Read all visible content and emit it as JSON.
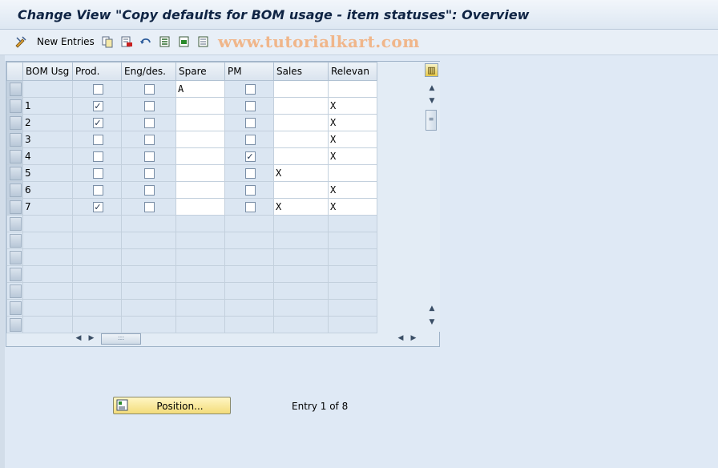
{
  "window": {
    "title": "Change View \"Copy defaults for BOM usage - item statuses\": Overview"
  },
  "toolbar": {
    "new_entries_label": "New Entries",
    "watermark": "www.tutorialkart.com"
  },
  "table": {
    "columns": [
      "BOM Usg",
      "Prod.",
      "Eng/des.",
      "Spare",
      "PM",
      "Sales",
      "Relevan"
    ],
    "rows": [
      {
        "bom": "",
        "prod": false,
        "eng": false,
        "spare": "A",
        "pm": false,
        "sales": "",
        "rel": ""
      },
      {
        "bom": "1",
        "prod": true,
        "eng": false,
        "spare": "",
        "pm": false,
        "sales": "",
        "rel": "X"
      },
      {
        "bom": "2",
        "prod": true,
        "eng": false,
        "spare": "",
        "pm": false,
        "sales": "",
        "rel": "X"
      },
      {
        "bom": "3",
        "prod": false,
        "eng": false,
        "spare": "",
        "pm": false,
        "sales": "",
        "rel": "X"
      },
      {
        "bom": "4",
        "prod": false,
        "eng": false,
        "spare": "",
        "pm": true,
        "sales": "",
        "rel": "X"
      },
      {
        "bom": "5",
        "prod": false,
        "eng": false,
        "spare": "",
        "pm": false,
        "sales": "X",
        "rel": ""
      },
      {
        "bom": "6",
        "prod": false,
        "eng": false,
        "spare": "",
        "pm": false,
        "sales": "",
        "rel": "X"
      },
      {
        "bom": "7",
        "prod": true,
        "eng": false,
        "spare": "",
        "pm": false,
        "sales": "X",
        "rel": "X"
      }
    ],
    "empty_rows": 7
  },
  "footer": {
    "position_label": "Position...",
    "entry_text": "Entry 1 of 8"
  }
}
